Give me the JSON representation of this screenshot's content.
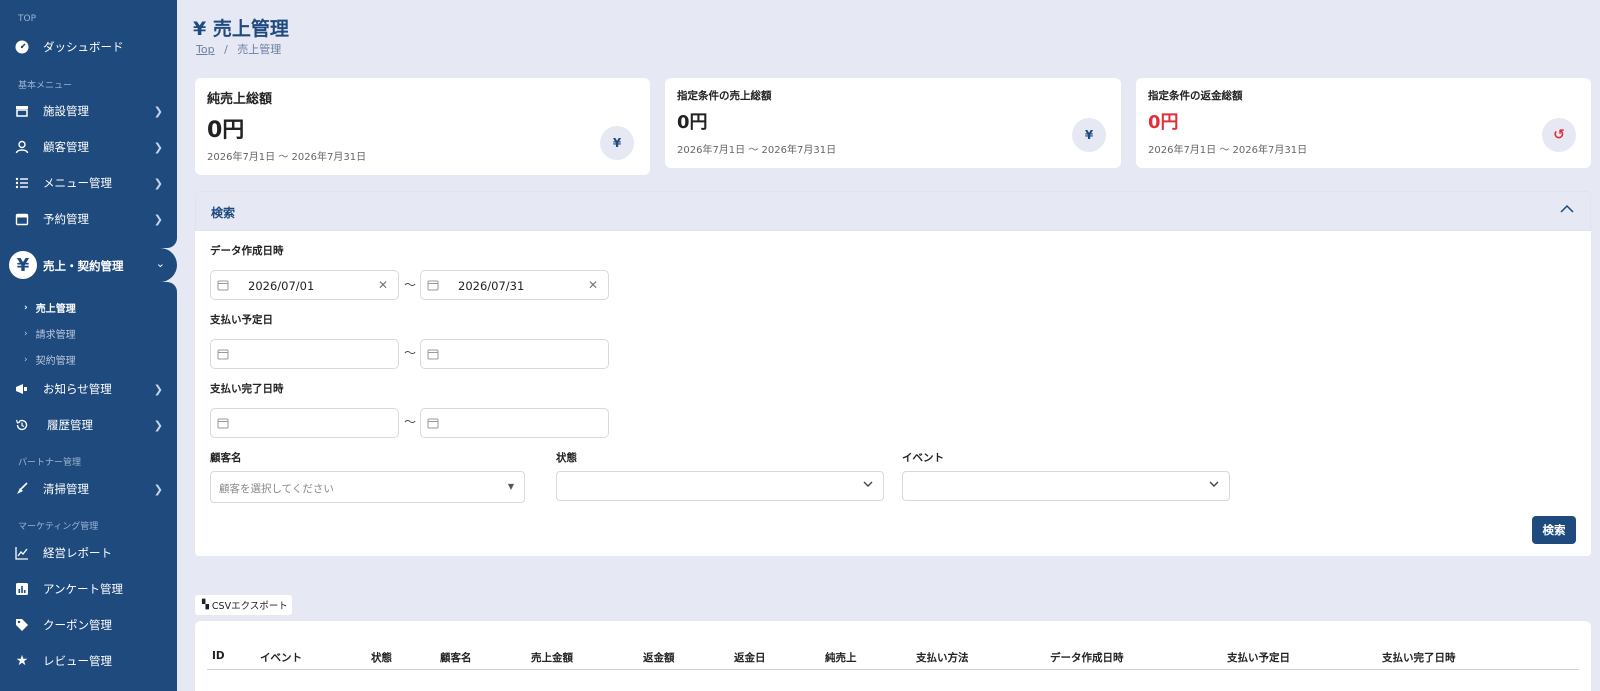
{
  "sidebar": {
    "top_section": "TOP",
    "dashboard": "ダッシュボード",
    "basic_section": "基本メニュー",
    "facility": "施設管理",
    "customer": "顧客管理",
    "menu": "メニュー管理",
    "reservation": "予約管理",
    "sales_contract": "売上・契約管理",
    "sub_items": [
      "売上管理",
      "請求管理",
      "契約管理"
    ],
    "notice": "お知らせ管理",
    "history": "履歴管理",
    "partner_section": "パートナー管理",
    "cleaning": "清掃管理",
    "marketing_section": "マーケティング管理",
    "report": "経営レポート",
    "survey": "アンケート管理",
    "coupon": "クーポン管理",
    "review": "レビュー管理"
  },
  "header": {
    "title": "売上管理",
    "title_icon": "¥",
    "breadcrumb_top": "Top",
    "breadcrumb_sep": "/",
    "breadcrumb_current": "売上管理"
  },
  "cards": [
    {
      "title": "純売上総額",
      "value": "0円",
      "range": "2026年7月1日 〜 2026年7月31日",
      "icon": "¥",
      "value_color": "#222222"
    },
    {
      "title": "指定条件の売上総額",
      "value": "0円",
      "range": "2026年7月1日 〜 2026年7月31日",
      "icon": "¥",
      "value_color": "#222222"
    },
    {
      "title": "指定条件の返金総額",
      "value": "0円",
      "range": "2026年7月1日 〜 2026年7月31日",
      "icon": "↺",
      "value_color": "#e0303c"
    }
  ],
  "search": {
    "header": "検索",
    "data_created_label": "データ作成日時",
    "data_created_from": "2026/07/01",
    "data_created_to": "2026/07/31",
    "tilde": "〜",
    "payment_due_label": "支払い予定日",
    "payment_done_label": "支払い完了日時",
    "customer_label": "顧客名",
    "customer_placeholder": "顧客を選択してください",
    "status_label": "状態",
    "event_label": "イベント",
    "button": "検索"
  },
  "csv_export": "CSVエクスポート",
  "table": {
    "columns": [
      "ID",
      "イベント",
      "状態",
      "顧客名",
      "売上金額",
      "返金額",
      "返金日",
      "純売上",
      "支払い方法",
      "データ作成日時",
      "支払い予定日",
      "支払い完了日時"
    ]
  },
  "colors": {
    "brand": "#1e4a7e",
    "background": "#e6e9f3",
    "refund": "#e0303c"
  }
}
